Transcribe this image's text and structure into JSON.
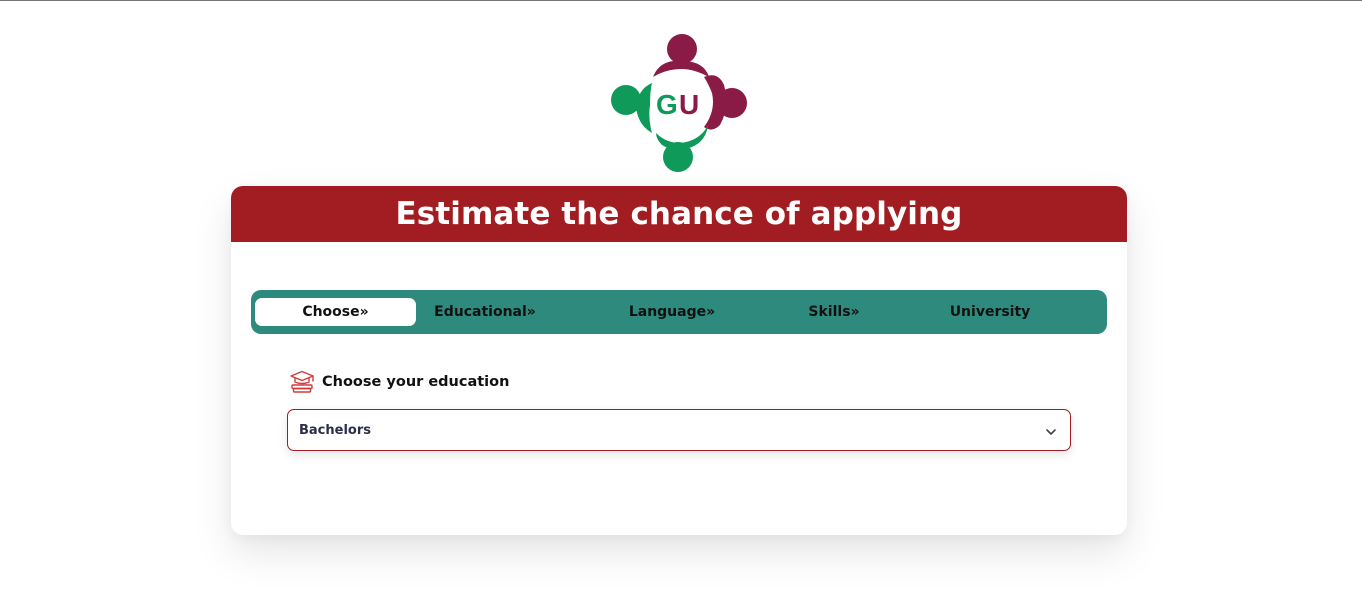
{
  "logo": {
    "letter_g": "G",
    "letter_u": "U",
    "colors": {
      "green": "#0f9a5a",
      "maroon": "#8a1a46"
    }
  },
  "header": {
    "title": "Estimate the chance of applying",
    "background": "#a11d21"
  },
  "steps": {
    "background": "#2d8a7d",
    "items": [
      {
        "label": "Choose»",
        "active": true
      },
      {
        "label": "Educational»",
        "active": false
      },
      {
        "label": "Language»",
        "active": false
      },
      {
        "label": "Skills»",
        "active": false
      },
      {
        "label": "University",
        "active": false
      }
    ]
  },
  "education": {
    "icon": "graduation-cap-icon",
    "label": "Choose your education",
    "selected_value": "Bachelors",
    "accent": "#a11d21"
  }
}
